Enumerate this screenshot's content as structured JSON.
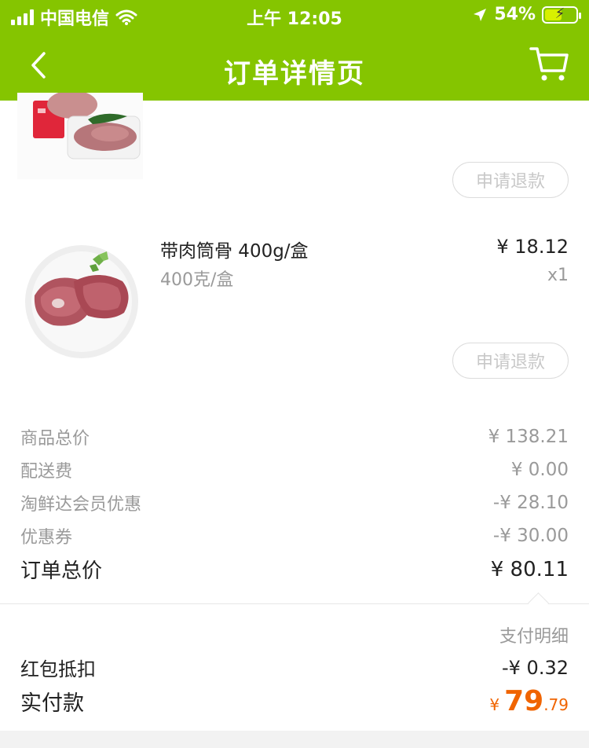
{
  "status_bar": {
    "carrier": "中国电信",
    "time": "上午 12:05",
    "battery": "54%",
    "battery_level": 0.54
  },
  "nav": {
    "title": "订单详情页",
    "back_icon": "chevron-left-icon",
    "cart_icon": "cart-icon"
  },
  "products": [
    {
      "name": "",
      "refund_label": "申请退款",
      "image_icon": "packaged-pork-image"
    },
    {
      "name": "带肉筒骨 400g/盒",
      "spec": "400克/盒",
      "price": "¥ 18.12",
      "qty": "x1",
      "refund_label": "申请退款",
      "image_icon": "pork-bone-plate-image"
    }
  ],
  "summary": {
    "goods_total_label": "商品总价",
    "goods_total": "¥ 138.21",
    "delivery_label": "配送费",
    "delivery": "¥ 0.00",
    "member_discount_label": "淘鲜达会员优惠",
    "member_discount": "-¥ 28.10",
    "coupon_label": "优惠券",
    "coupon": "-¥ 30.00",
    "order_total_label": "订单总价",
    "order_total": "¥ 80.11"
  },
  "payment": {
    "detail_link": "支付明细",
    "red_packet_label": "红包抵扣",
    "red_packet": "-¥ 0.32",
    "paid_label": "实付款",
    "paid_currency": "¥",
    "paid_integer": "79",
    "paid_decimal": ".79"
  },
  "colors": {
    "brand_green": "#85c500",
    "price_orange": "#f06400"
  }
}
